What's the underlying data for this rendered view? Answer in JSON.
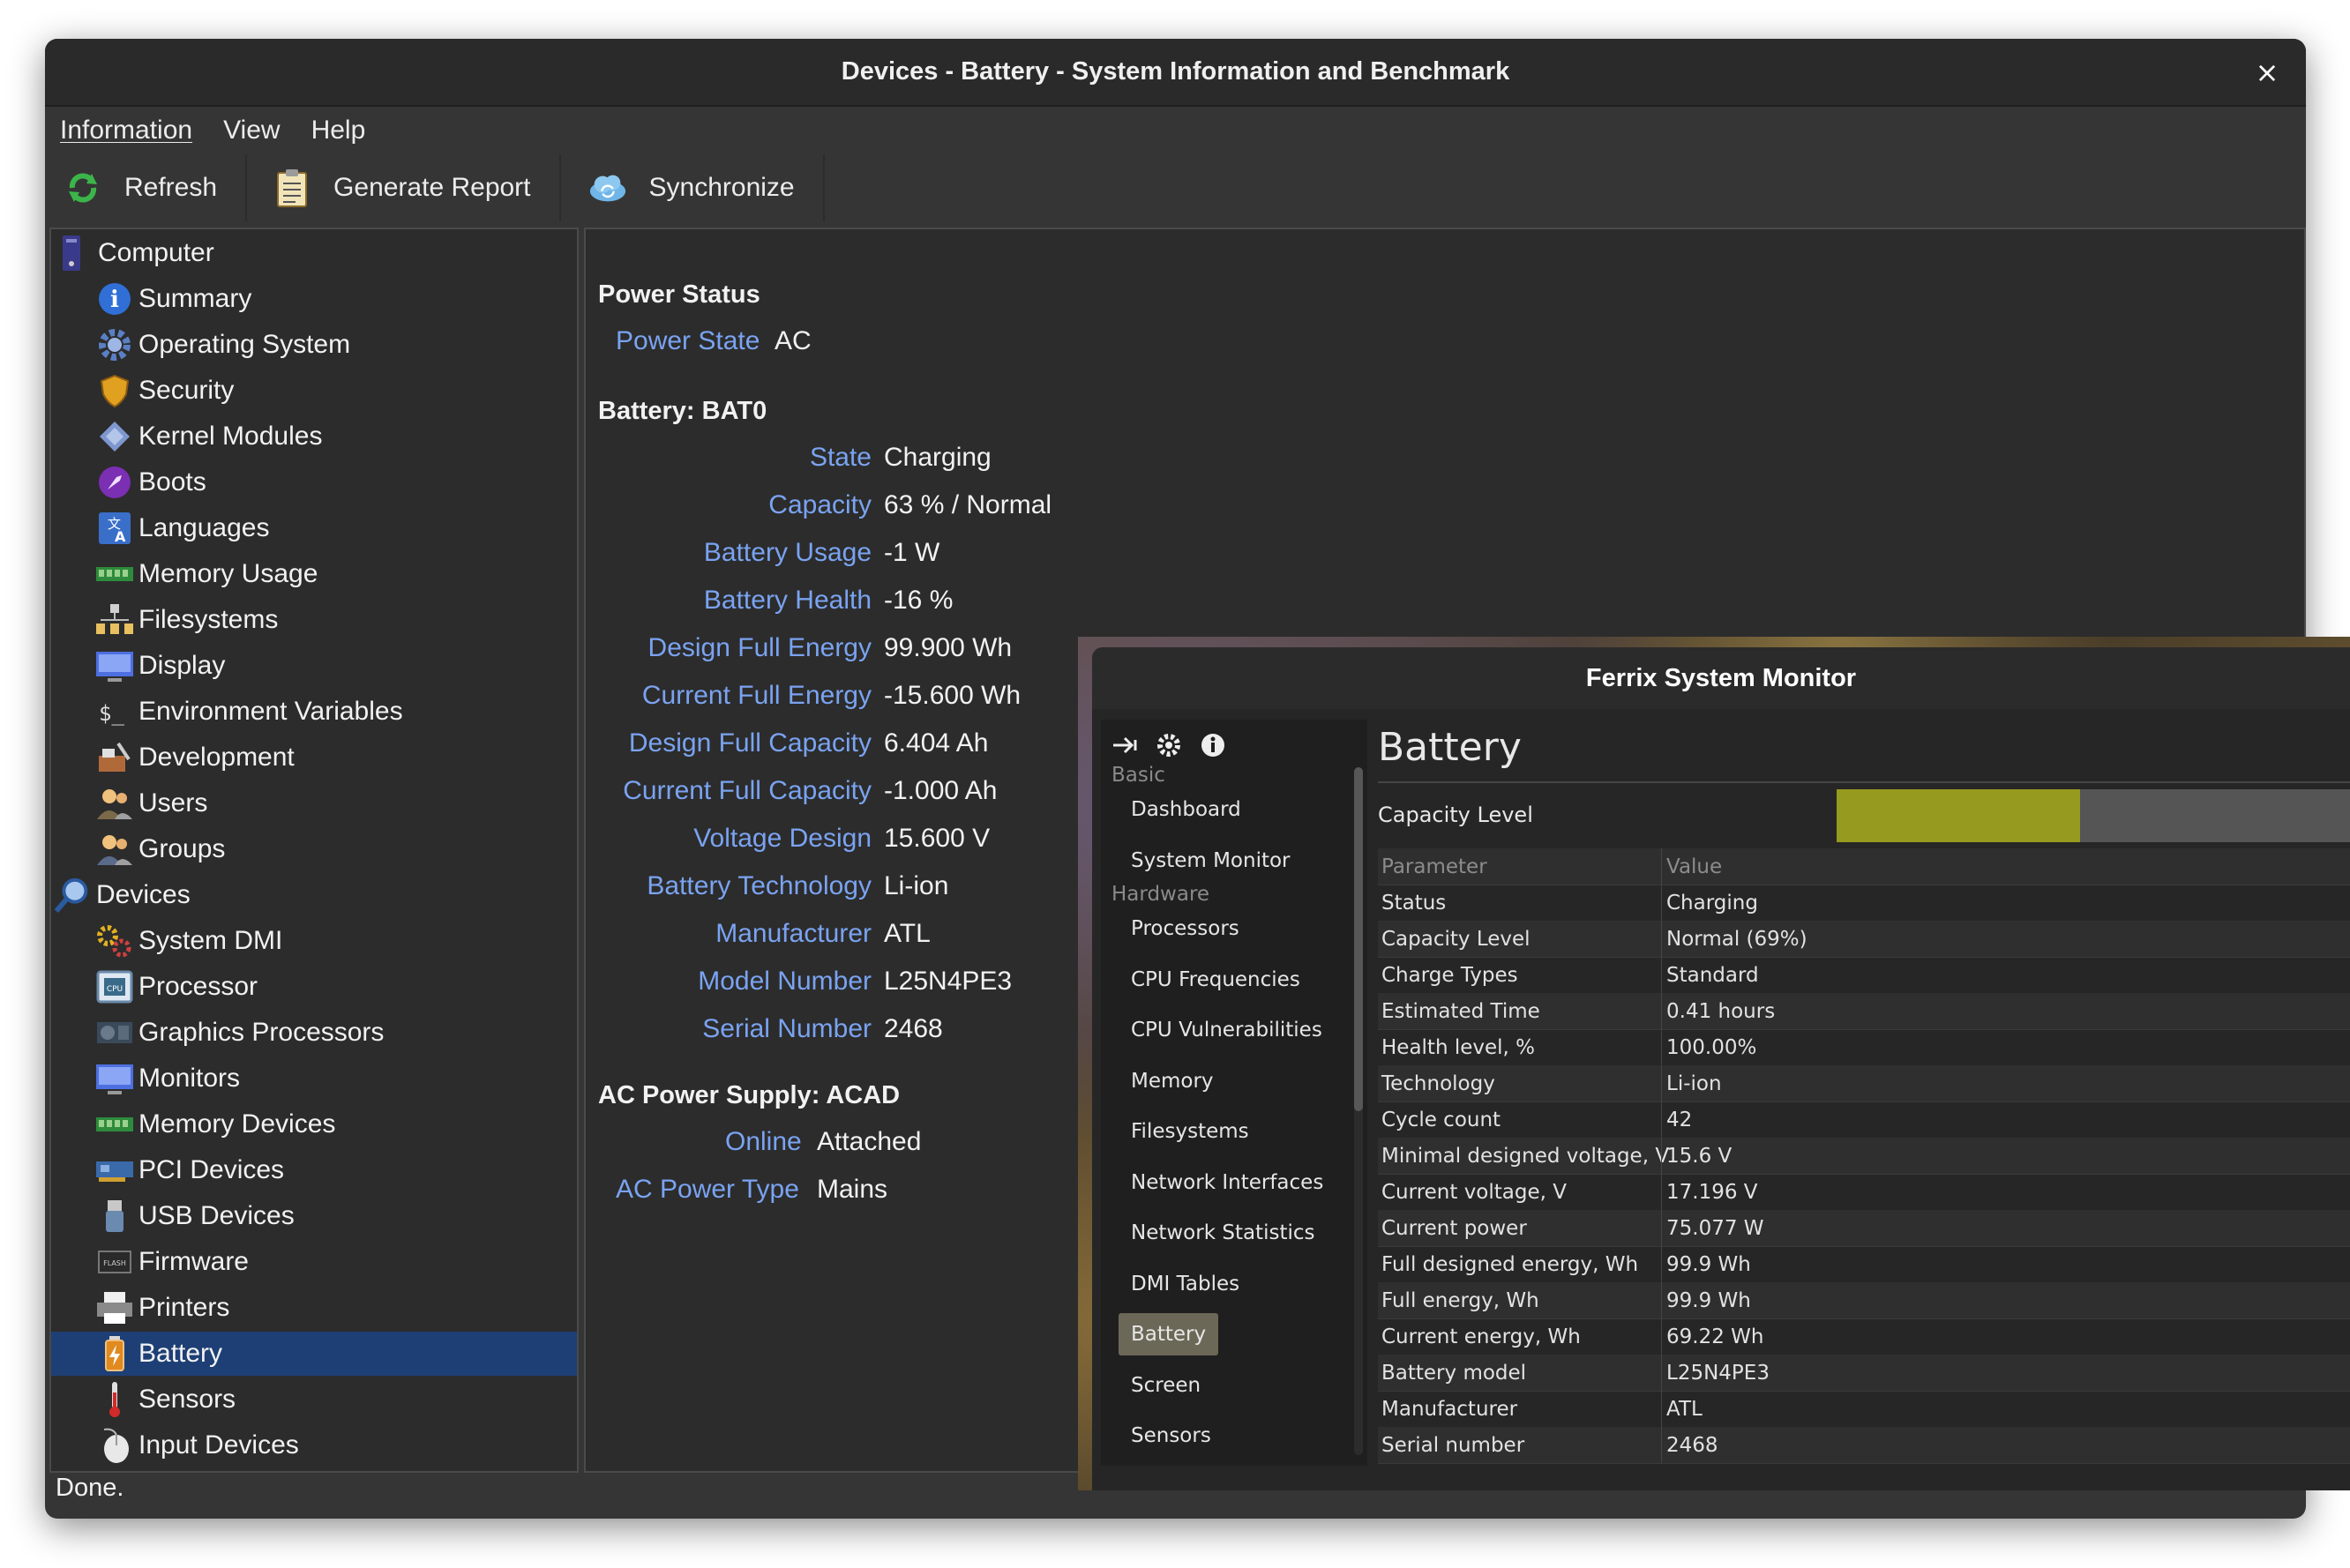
{
  "hardinfo": {
    "title": "Devices - Battery - System Information and Benchmark",
    "close": "×",
    "menu": [
      "Information",
      "View",
      "Help"
    ],
    "toolbar": {
      "refresh": "Refresh",
      "generate_report": "Generate Report",
      "synchronize": "Synchronize"
    },
    "tree": {
      "computer": "Computer",
      "computer_items": [
        "Summary",
        "Operating System",
        "Security",
        "Kernel Modules",
        "Boots",
        "Languages",
        "Memory Usage",
        "Filesystems",
        "Display",
        "Environment Variables",
        "Development",
        "Users",
        "Groups"
      ],
      "devices": "Devices",
      "devices_items": [
        "System DMI",
        "Processor",
        "Graphics Processors",
        "Monitors",
        "Memory Devices",
        "PCI Devices",
        "USB Devices",
        "Firmware",
        "Printers",
        "Battery",
        "Sensors",
        "Input Devices"
      ],
      "selected": "Battery"
    },
    "detail": {
      "power_status": {
        "heading": "Power Status",
        "rows": [
          {
            "key": "Power State",
            "value": "AC"
          }
        ]
      },
      "battery": {
        "heading": "Battery: BAT0",
        "rows": [
          {
            "key": "State",
            "value": "Charging"
          },
          {
            "key": "Capacity",
            "value": "63 % / Normal"
          },
          {
            "key": "Battery Usage",
            "value": "-1 W"
          },
          {
            "key": "Battery Health",
            "value": "-16 %"
          },
          {
            "key": "Design Full Energy",
            "value": "99.900 Wh"
          },
          {
            "key": "Current Full Energy",
            "value": "-15.600 Wh"
          },
          {
            "key": "Design Full Capacity",
            "value": "6.404 Ah"
          },
          {
            "key": "Current Full Capacity",
            "value": "-1.000 Ah"
          },
          {
            "key": "Voltage Design",
            "value": "15.600 V"
          },
          {
            "key": "Battery Technology",
            "value": "Li-ion"
          },
          {
            "key": "Manufacturer",
            "value": "ATL"
          },
          {
            "key": "Model Number",
            "value": "L25N4PE3"
          },
          {
            "key": "Serial Number",
            "value": "2468"
          }
        ]
      },
      "ac_supply": {
        "heading": "AC Power Supply: ACAD",
        "rows": [
          {
            "key": "Online",
            "value": "Attached"
          },
          {
            "key": "AC Power Type",
            "value": "Mains"
          }
        ]
      }
    },
    "status": "Done."
  },
  "ferrix": {
    "title": "Ferrix System Monitor",
    "nav": {
      "icons": [
        "collapse-arrow-icon",
        "gear-icon",
        "info-icon"
      ],
      "sections": [
        {
          "label": "Basic",
          "items": [
            "Dashboard",
            "System Monitor"
          ]
        },
        {
          "label": "Hardware",
          "items": [
            "Processors",
            "CPU Frequencies",
            "CPU Vulnerabilities",
            "Memory",
            "Filesystems",
            "Network Interfaces",
            "Network Statistics",
            "DMI Tables",
            "Battery",
            "Screen",
            "Sensors"
          ]
        }
      ],
      "active": "Battery"
    },
    "heading": "Battery",
    "capacity_label": "Capacity Level",
    "capacity_fraction": 0.46,
    "capacity_color": "#969a1e",
    "table": {
      "headers": [
        "Parameter",
        "Value"
      ],
      "rows": [
        [
          "Status",
          "Charging"
        ],
        [
          "Capacity Level",
          "Normal (69%)"
        ],
        [
          "Charge Types",
          "Standard"
        ],
        [
          "Estimated Time",
          "0.41 hours"
        ],
        [
          "Health level, %",
          "100.00%"
        ],
        [
          "Technology",
          "Li-ion"
        ],
        [
          "Cycle count",
          "42"
        ],
        [
          "Minimal designed voltage, V",
          "15.6 V"
        ],
        [
          "Current voltage, V",
          "17.196 V"
        ],
        [
          "Current power",
          "75.077 W"
        ],
        [
          "Full designed energy, Wh",
          "99.9 Wh"
        ],
        [
          "Full energy, Wh",
          "99.9 Wh"
        ],
        [
          "Current energy, Wh",
          "69.22 Wh"
        ],
        [
          "Battery model",
          "L25N4PE3"
        ],
        [
          "Manufacturer",
          "ATL"
        ],
        [
          "Serial number",
          "2468"
        ]
      ]
    }
  },
  "colors": {
    "key_blue": "#7aa3f1",
    "selection": "#1d3f75",
    "window_bg": "#353535"
  }
}
